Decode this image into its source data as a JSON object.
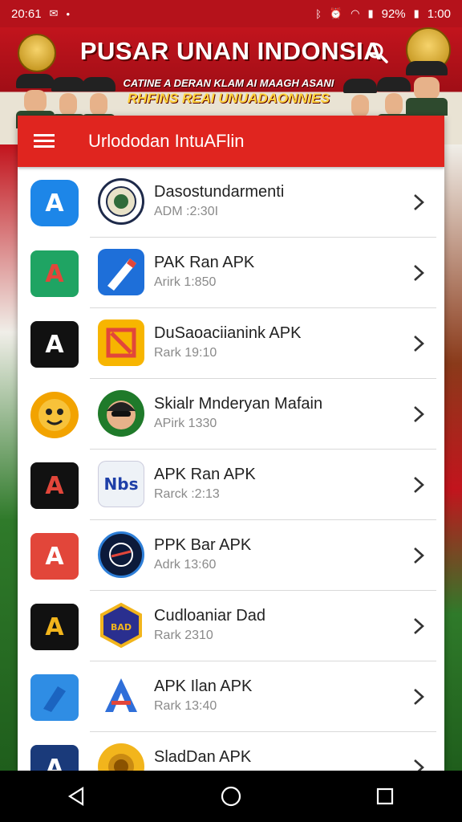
{
  "status_bar": {
    "time_left": "20:61",
    "battery": "92%",
    "time_right": "1:00"
  },
  "header": {
    "app_title": "PUSAR UNAN INDONSIA",
    "slogan_line1": "CATINE A DERAN KLAM AI MAAGH ASANI",
    "slogan_line2": "RHFINS REAI UNUADAONNIES"
  },
  "toolbar": {
    "title": "Urlododan IntuAFlin"
  },
  "apps": [
    {
      "title": "Dasostundarmenti",
      "subtitle": "ADM :2:30I",
      "icon_a": "A",
      "icon_a_color": "#1d86e8",
      "icon_b": "seal",
      "icon_b_color": "#ffffff"
    },
    {
      "title": "PAK Ran APK",
      "subtitle": "Arirk 1:850",
      "icon_a": "A",
      "icon_a_color": "#1fa463",
      "icon_b": "P",
      "icon_b_color": "#1e6fd9"
    },
    {
      "title": "DuSaoaciianink APK",
      "subtitle": "Rark 19:10",
      "icon_a": "A",
      "icon_a_color": "#111111",
      "icon_b": "S",
      "icon_b_color": "#f7b500"
    },
    {
      "title": "Skialr Mnderyan Mafain",
      "subtitle": "APirk 1330",
      "icon_a": "face",
      "icon_a_color": "#f2a300",
      "icon_b": "person",
      "icon_b_color": "#1f7a2a"
    },
    {
      "title": "APK Ran APK",
      "subtitle": "Rarck :2:13",
      "icon_a": "A",
      "icon_a_color": "#111111",
      "icon_b": "Nbs",
      "icon_b_color": "#eef2f7"
    },
    {
      "title": "PPK Bar APK",
      "subtitle": "Adrk 13:60",
      "icon_a": "A",
      "icon_a_color": "#e2463a",
      "icon_b": "circle",
      "icon_b_color": "#0c1a3a"
    },
    {
      "title": "Cudloaniar Dad",
      "subtitle": "Rark 2310",
      "icon_a": "A",
      "icon_a_color": "#111111",
      "icon_b": "hex",
      "icon_b_color": "#2a2f8f"
    },
    {
      "title": "APK Ilan APK",
      "subtitle": "Rark 13:40",
      "icon_a": "shape",
      "icon_a_color": "#2f8de4",
      "icon_b": "A",
      "icon_b_color": "#ffffff"
    },
    {
      "title": "SladDan APK",
      "subtitle": "",
      "icon_a": "A",
      "icon_a_color": "#1a3a7a",
      "icon_b": "badge",
      "icon_b_color": "#f2b51c"
    }
  ],
  "colors": {
    "primary_red": "#e0251f",
    "status_red": "#b5121b",
    "navbar": "#000000"
  }
}
